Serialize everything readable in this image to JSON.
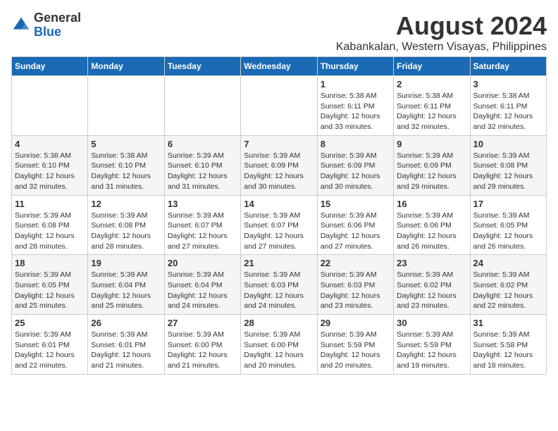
{
  "logo": {
    "general": "General",
    "blue": "Blue"
  },
  "title": "August 2024",
  "subtitle": "Kabankalan, Western Visayas, Philippines",
  "days_of_week": [
    "Sunday",
    "Monday",
    "Tuesday",
    "Wednesday",
    "Thursday",
    "Friday",
    "Saturday"
  ],
  "weeks": [
    [
      {
        "day": "",
        "info": ""
      },
      {
        "day": "",
        "info": ""
      },
      {
        "day": "",
        "info": ""
      },
      {
        "day": "",
        "info": ""
      },
      {
        "day": "1",
        "info": "Sunrise: 5:38 AM\nSunset: 6:11 PM\nDaylight: 12 hours\nand 33 minutes."
      },
      {
        "day": "2",
        "info": "Sunrise: 5:38 AM\nSunset: 6:11 PM\nDaylight: 12 hours\nand 32 minutes."
      },
      {
        "day": "3",
        "info": "Sunrise: 5:38 AM\nSunset: 6:11 PM\nDaylight: 12 hours\nand 32 minutes."
      }
    ],
    [
      {
        "day": "4",
        "info": "Sunrise: 5:38 AM\nSunset: 6:10 PM\nDaylight: 12 hours\nand 32 minutes."
      },
      {
        "day": "5",
        "info": "Sunrise: 5:38 AM\nSunset: 6:10 PM\nDaylight: 12 hours\nand 31 minutes."
      },
      {
        "day": "6",
        "info": "Sunrise: 5:39 AM\nSunset: 6:10 PM\nDaylight: 12 hours\nand 31 minutes."
      },
      {
        "day": "7",
        "info": "Sunrise: 5:39 AM\nSunset: 6:09 PM\nDaylight: 12 hours\nand 30 minutes."
      },
      {
        "day": "8",
        "info": "Sunrise: 5:39 AM\nSunset: 6:09 PM\nDaylight: 12 hours\nand 30 minutes."
      },
      {
        "day": "9",
        "info": "Sunrise: 5:39 AM\nSunset: 6:09 PM\nDaylight: 12 hours\nand 29 minutes."
      },
      {
        "day": "10",
        "info": "Sunrise: 5:39 AM\nSunset: 6:08 PM\nDaylight: 12 hours\nand 29 minutes."
      }
    ],
    [
      {
        "day": "11",
        "info": "Sunrise: 5:39 AM\nSunset: 6:08 PM\nDaylight: 12 hours\nand 28 minutes."
      },
      {
        "day": "12",
        "info": "Sunrise: 5:39 AM\nSunset: 6:08 PM\nDaylight: 12 hours\nand 28 minutes."
      },
      {
        "day": "13",
        "info": "Sunrise: 5:39 AM\nSunset: 6:07 PM\nDaylight: 12 hours\nand 27 minutes."
      },
      {
        "day": "14",
        "info": "Sunrise: 5:39 AM\nSunset: 6:07 PM\nDaylight: 12 hours\nand 27 minutes."
      },
      {
        "day": "15",
        "info": "Sunrise: 5:39 AM\nSunset: 6:06 PM\nDaylight: 12 hours\nand 27 minutes."
      },
      {
        "day": "16",
        "info": "Sunrise: 5:39 AM\nSunset: 6:06 PM\nDaylight: 12 hours\nand 26 minutes."
      },
      {
        "day": "17",
        "info": "Sunrise: 5:39 AM\nSunset: 6:05 PM\nDaylight: 12 hours\nand 26 minutes."
      }
    ],
    [
      {
        "day": "18",
        "info": "Sunrise: 5:39 AM\nSunset: 6:05 PM\nDaylight: 12 hours\nand 25 minutes."
      },
      {
        "day": "19",
        "info": "Sunrise: 5:39 AM\nSunset: 6:04 PM\nDaylight: 12 hours\nand 25 minutes."
      },
      {
        "day": "20",
        "info": "Sunrise: 5:39 AM\nSunset: 6:04 PM\nDaylight: 12 hours\nand 24 minutes."
      },
      {
        "day": "21",
        "info": "Sunrise: 5:39 AM\nSunset: 6:03 PM\nDaylight: 12 hours\nand 24 minutes."
      },
      {
        "day": "22",
        "info": "Sunrise: 5:39 AM\nSunset: 6:03 PM\nDaylight: 12 hours\nand 23 minutes."
      },
      {
        "day": "23",
        "info": "Sunrise: 5:39 AM\nSunset: 6:02 PM\nDaylight: 12 hours\nand 23 minutes."
      },
      {
        "day": "24",
        "info": "Sunrise: 5:39 AM\nSunset: 6:02 PM\nDaylight: 12 hours\nand 22 minutes."
      }
    ],
    [
      {
        "day": "25",
        "info": "Sunrise: 5:39 AM\nSunset: 6:01 PM\nDaylight: 12 hours\nand 22 minutes."
      },
      {
        "day": "26",
        "info": "Sunrise: 5:39 AM\nSunset: 6:01 PM\nDaylight: 12 hours\nand 21 minutes."
      },
      {
        "day": "27",
        "info": "Sunrise: 5:39 AM\nSunset: 6:00 PM\nDaylight: 12 hours\nand 21 minutes."
      },
      {
        "day": "28",
        "info": "Sunrise: 5:39 AM\nSunset: 6:00 PM\nDaylight: 12 hours\nand 20 minutes."
      },
      {
        "day": "29",
        "info": "Sunrise: 5:39 AM\nSunset: 5:59 PM\nDaylight: 12 hours\nand 20 minutes."
      },
      {
        "day": "30",
        "info": "Sunrise: 5:39 AM\nSunset: 5:59 PM\nDaylight: 12 hours\nand 19 minutes."
      },
      {
        "day": "31",
        "info": "Sunrise: 5:39 AM\nSunset: 5:58 PM\nDaylight: 12 hours\nand 18 minutes."
      }
    ]
  ]
}
